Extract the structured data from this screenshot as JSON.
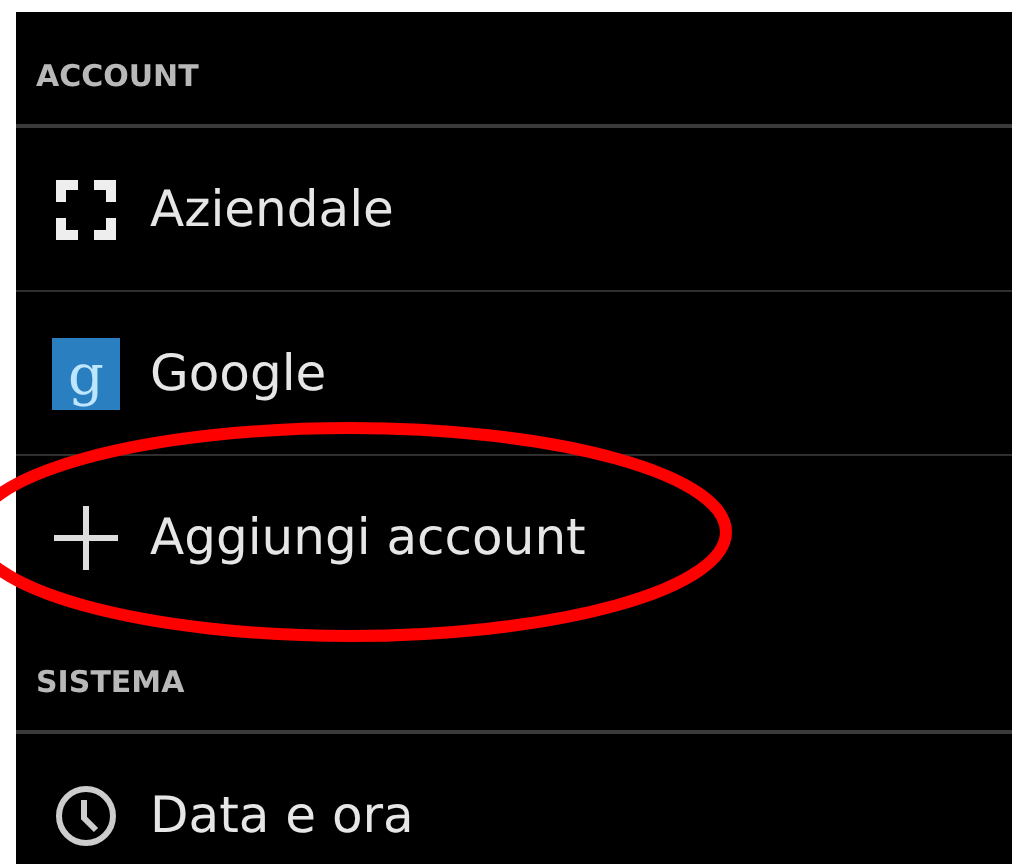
{
  "sections": [
    {
      "header": "ACCOUNT",
      "items": [
        {
          "label": "Aziendale",
          "kind": "work",
          "circled": false
        },
        {
          "label": "Google",
          "kind": "google",
          "icon_text": "g",
          "circled": false
        },
        {
          "label": "Aggiungi account",
          "kind": "add",
          "circled": true
        }
      ]
    },
    {
      "header": "SISTEMA",
      "items": [
        {
          "label": "Data e ora",
          "kind": "clock",
          "circled": false
        }
      ]
    }
  ]
}
